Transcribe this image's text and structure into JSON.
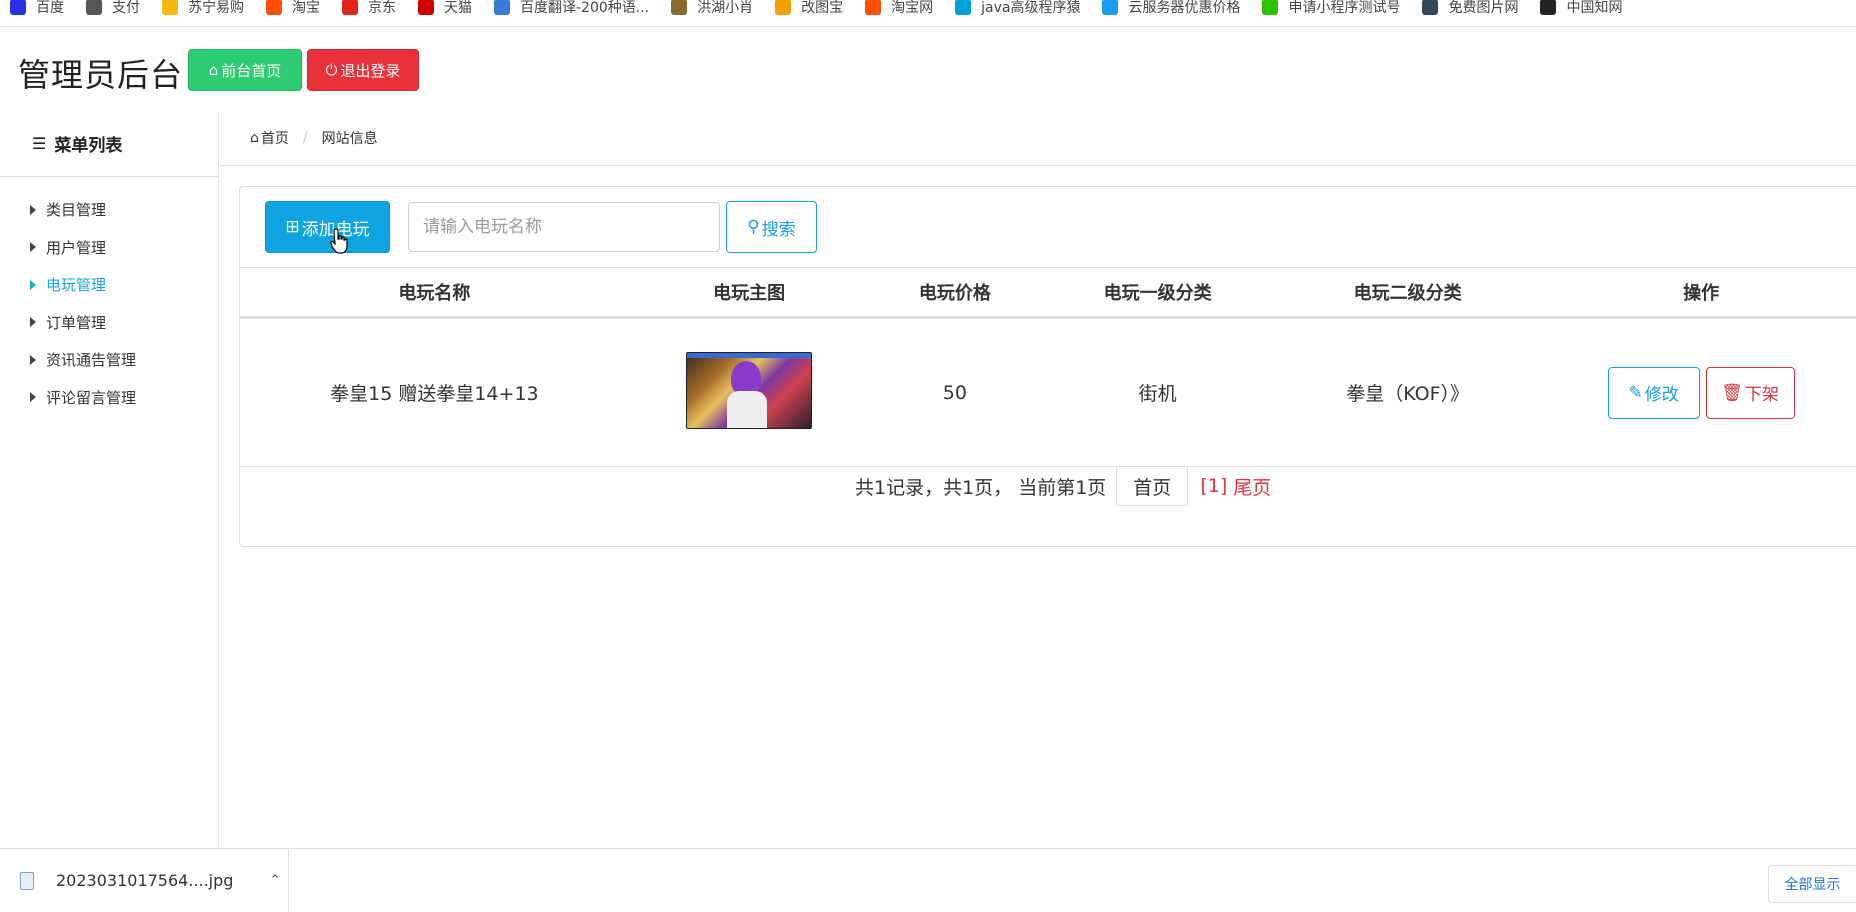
{
  "bookmarks": [
    {
      "label": "百度",
      "icon": "baidu-paw-icon",
      "color": "#2932e1"
    },
    {
      "label": "支付",
      "icon": "globe-icon",
      "color": "#555555"
    },
    {
      "label": "苏宁易购",
      "icon": "suning-icon",
      "color": "#f5b90c"
    },
    {
      "label": "淘宝",
      "icon": "taobao-icon",
      "color": "#ff5000"
    },
    {
      "label": "京东",
      "icon": "jd-icon",
      "color": "#e1251b"
    },
    {
      "label": "天猫",
      "icon": "tmall-icon",
      "color": "#d00000"
    },
    {
      "label": "百度翻译-200种语...",
      "icon": "translate-icon",
      "color": "#3a7bd5"
    },
    {
      "label": "洪湖小肖",
      "icon": "bird-icon",
      "color": "#8a6a2a"
    },
    {
      "label": "改图宝",
      "icon": "folder-icon",
      "color": "#f5a000"
    },
    {
      "label": "淘宝网",
      "icon": "taobao-icon",
      "color": "#ff5000"
    },
    {
      "label": "java高级程序猿",
      "icon": "bilibili-icon",
      "color": "#00a1d6"
    },
    {
      "label": "云服务器优惠价格",
      "icon": "cloud-icon",
      "color": "#1a9af0"
    },
    {
      "label": "申请小程序测试号",
      "icon": "wechat-icon",
      "color": "#2dc100"
    },
    {
      "label": "免费图片网",
      "icon": "tumblr-icon",
      "color": "#35465c"
    },
    {
      "label": "中国知网",
      "icon": "cnki-icon",
      "color": "#222222"
    }
  ],
  "header": {
    "title": "管理员后台",
    "home_button": "前台首页",
    "logout_button": "退出登录"
  },
  "sidebar": {
    "heading": "菜单列表",
    "items": [
      {
        "label": "类目管理",
        "active": false
      },
      {
        "label": "用户管理",
        "active": false
      },
      {
        "label": "电玩管理",
        "active": true
      },
      {
        "label": "订单管理",
        "active": false
      },
      {
        "label": "资讯通告管理",
        "active": false
      },
      {
        "label": "评论留言管理",
        "active": false
      }
    ]
  },
  "breadcrumb": {
    "home": "首页",
    "current": "网站信息"
  },
  "toolbar": {
    "add_label": "添加电玩",
    "search_placeholder": "请输入电玩名称",
    "search_label": "搜索"
  },
  "table": {
    "headers": [
      "电玩名称",
      "电玩主图",
      "电玩价格",
      "电玩一级分类",
      "电玩二级分类",
      "操作"
    ],
    "rows": [
      {
        "name": "拳皇15 赠送拳皇14+13",
        "image": "game-cover-thumbnail",
        "price": "50",
        "category1": "街机",
        "category2": "拳皇（KOF）》",
        "edit_label": "修改",
        "remove_label": "下架"
      }
    ]
  },
  "pager": {
    "summary": "共1记录，共1页， 当前第1页",
    "first_label": "首页",
    "current_page": "[1]",
    "last_label": "尾页"
  },
  "downloads": {
    "file_name": "2023031017564....jpg",
    "show_all": "全部显示"
  },
  "colors": {
    "accent": "#18a8d8",
    "add_button": "#10a3e1",
    "home_button": "#2ecc71",
    "logout_button": "#e8313a",
    "danger": "#d9363e"
  }
}
